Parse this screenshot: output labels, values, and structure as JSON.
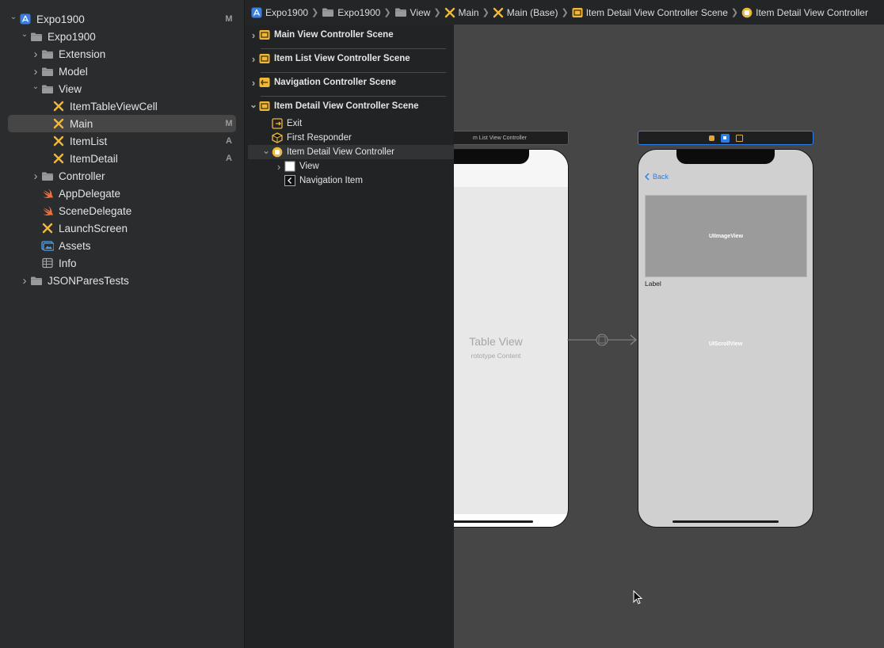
{
  "navigator": {
    "items": [
      {
        "label": "Expo1900",
        "badge": "M",
        "level": 0,
        "chevron": "down",
        "icon": "project-icon"
      },
      {
        "label": "Expo1900",
        "badge": "",
        "level": 1,
        "chevron": "down",
        "icon": "folder-icon"
      },
      {
        "label": "Extension",
        "badge": "",
        "level": 2,
        "chevron": "right",
        "icon": "folder-icon"
      },
      {
        "label": "Model",
        "badge": "",
        "level": 2,
        "chevron": "right",
        "icon": "folder-icon"
      },
      {
        "label": "View",
        "badge": "",
        "level": 2,
        "chevron": "down",
        "icon": "folder-icon"
      },
      {
        "label": "ItemTableViewCell",
        "badge": "",
        "level": 3,
        "chevron": "",
        "icon": "xib-icon"
      },
      {
        "label": "Main",
        "badge": "M",
        "level": 3,
        "chevron": "",
        "icon": "xib-icon",
        "selected": true
      },
      {
        "label": "ItemList",
        "badge": "A",
        "level": 3,
        "chevron": "",
        "icon": "xib-icon"
      },
      {
        "label": "ItemDetail",
        "badge": "A",
        "level": 3,
        "chevron": "",
        "icon": "xib-icon"
      },
      {
        "label": "Controller",
        "badge": "",
        "level": 2,
        "chevron": "right",
        "icon": "folder-icon"
      },
      {
        "label": "AppDelegate",
        "badge": "",
        "level": 2,
        "chevron": "",
        "icon": "swift-icon"
      },
      {
        "label": "SceneDelegate",
        "badge": "",
        "level": 2,
        "chevron": "",
        "icon": "swift-icon"
      },
      {
        "label": "LaunchScreen",
        "badge": "",
        "level": 2,
        "chevron": "",
        "icon": "xib-icon"
      },
      {
        "label": "Assets",
        "badge": "",
        "level": 2,
        "chevron": "",
        "icon": "assets-icon"
      },
      {
        "label": "Info",
        "badge": "",
        "level": 2,
        "chevron": "",
        "icon": "plist-icon"
      },
      {
        "label": "JSONParesTests",
        "badge": "",
        "level": 1,
        "chevron": "right",
        "icon": "folder-icon"
      }
    ]
  },
  "jumpbar": {
    "crumbs": [
      {
        "label": "Expo1900",
        "icon": "project-icon"
      },
      {
        "label": "Expo1900",
        "icon": "folder-icon"
      },
      {
        "label": "View",
        "icon": "folder-icon"
      },
      {
        "label": "Main",
        "icon": "xib-icon"
      },
      {
        "label": "Main (Base)",
        "icon": "xib-icon"
      },
      {
        "label": "Item Detail View Controller Scene",
        "icon": "scene-icon"
      },
      {
        "label": "Item Detail View Controller",
        "icon": "vc-icon"
      }
    ]
  },
  "outline": {
    "scenes": [
      {
        "label": "Main View Controller Scene"
      },
      {
        "label": "Item List View Controller Scene"
      },
      {
        "label": "Navigation Controller Scene"
      },
      {
        "label": "Item Detail View Controller Scene"
      }
    ],
    "children": [
      {
        "label": "Exit",
        "icon": "exit-icon"
      },
      {
        "label": "First Responder",
        "icon": "first-responder-icon"
      },
      {
        "label": "Item Detail View Controller",
        "icon": "vc-icon"
      },
      {
        "label": "View",
        "icon": "view-icon"
      },
      {
        "label": "Navigation Item",
        "icon": "navigation-item-icon"
      }
    ]
  },
  "canvas": {
    "list_scene_bar": "m List View Controller",
    "table_view_title": "Table View",
    "table_view_subtitle": "rototype Content",
    "back_label": "Back",
    "image_view_label": "UIImageView",
    "label_text": "Label",
    "scroll_view_label": "UIScrollView"
  },
  "colors": {
    "accent": "#2b7de9",
    "storyboard_yellow": "#f0b73a",
    "swift_orange": "#f0703c",
    "folder_gray": "#9a9a9a"
  }
}
